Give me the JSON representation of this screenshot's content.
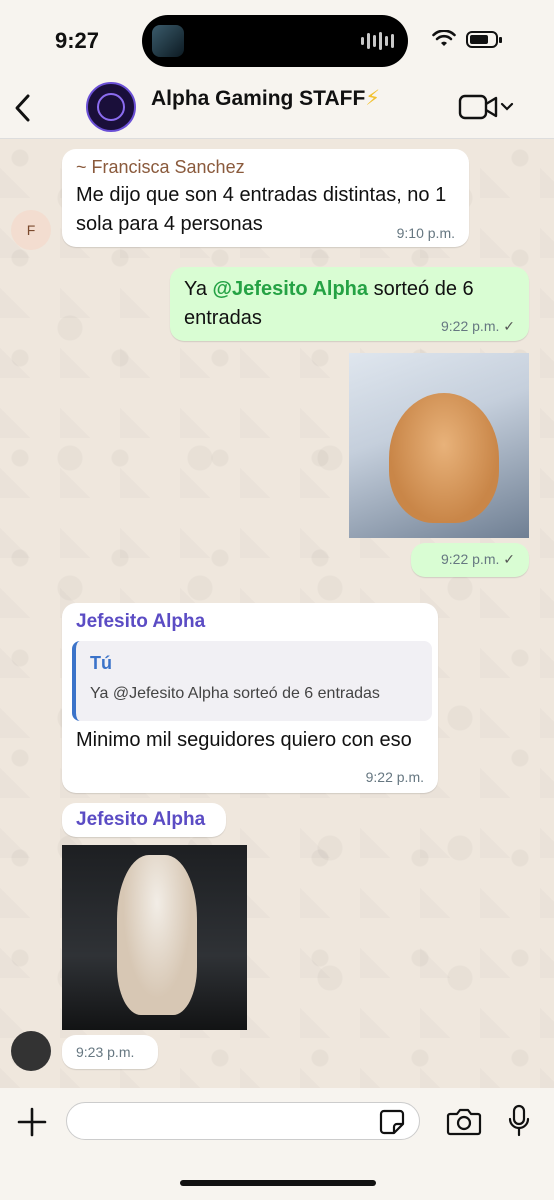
{
  "status_bar": {
    "time": "9:27"
  },
  "header": {
    "title": "Alpha Gaming STAFF",
    "title_emoji": "⚡"
  },
  "messages": [
    {
      "sender": "~ Francisca Sanchez",
      "text": "Me dijo que son 4 entradas distintas, no 1 sola para 4 personas",
      "time": "9:10 p.m.",
      "avatar_letter": "F"
    },
    {
      "text_prefix": "Ya ",
      "mention": "@Jefesito Alpha",
      "text_suffix": " sorteó de 6 entradas",
      "time": "9:22 p.m.",
      "tick": "✓"
    },
    {
      "time": "9:22 p.m.",
      "tick": "✓"
    },
    {
      "sender": "Jefesito Alpha",
      "quote_author": "Tú",
      "quote_text_prefix": "Ya @",
      "quote_mention": "Jefesito Alpha",
      "quote_text_suffix": " sorteó de 6 entradas",
      "text": "Minimo mil seguidores quiero con eso",
      "time": "9:22 p.m."
    },
    {
      "sender": "Jefesito Alpha",
      "time": "9:23 p.m."
    }
  ],
  "composer": {
    "placeholder": ""
  }
}
